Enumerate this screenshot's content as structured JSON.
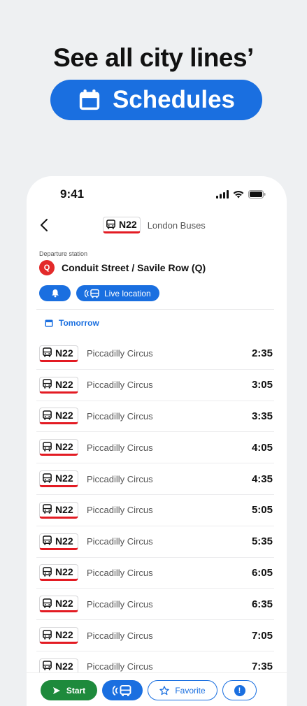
{
  "promo": {
    "headline": "See all city lines’",
    "pill_label": "Schedules"
  },
  "status_bar": {
    "time": "9:41"
  },
  "header": {
    "line": "N22",
    "operator": "London Buses"
  },
  "departure": {
    "label": "Departure station",
    "station_icon": "Q",
    "station_name": "Conduit Street / Savile Row (Q)",
    "live_location_label": "Live location"
  },
  "date_label": "Tomorrow",
  "rows": [
    {
      "line": "N22",
      "destination": "Piccadilly Circus",
      "time": "2:35"
    },
    {
      "line": "N22",
      "destination": "Piccadilly Circus",
      "time": "3:05"
    },
    {
      "line": "N22",
      "destination": "Piccadilly Circus",
      "time": "3:35"
    },
    {
      "line": "N22",
      "destination": "Piccadilly Circus",
      "time": "4:05"
    },
    {
      "line": "N22",
      "destination": "Piccadilly Circus",
      "time": "4:35"
    },
    {
      "line": "N22",
      "destination": "Piccadilly Circus",
      "time": "5:05"
    },
    {
      "line": "N22",
      "destination": "Piccadilly Circus",
      "time": "5:35"
    },
    {
      "line": "N22",
      "destination": "Piccadilly Circus",
      "time": "6:05"
    },
    {
      "line": "N22",
      "destination": "Piccadilly Circus",
      "time": "6:35"
    },
    {
      "line": "N22",
      "destination": "Piccadilly Circus",
      "time": "7:05"
    },
    {
      "line": "N22",
      "destination": "Piccadilly Circus",
      "time": "7:35"
    }
  ],
  "bottom_bar": {
    "start_label": "Start",
    "favorite_label": "Favorite"
  },
  "colors": {
    "accent": "#1a6fe0",
    "start_green": "#1e8a3c",
    "line_red": "#e31b23"
  }
}
